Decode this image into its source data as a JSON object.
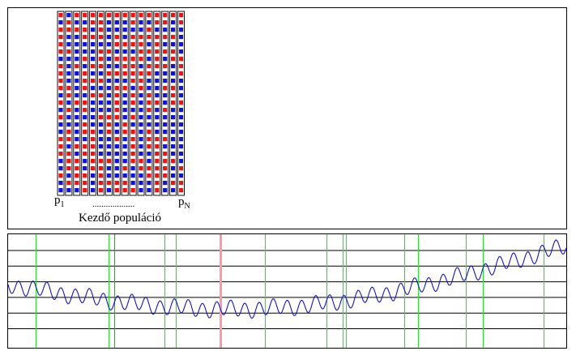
{
  "population_panel": {
    "chromosome_count": 16,
    "genes_per_chromosome": 25,
    "gene_colors": {
      "a": "#1010dd",
      "b": "#ee1111"
    },
    "first_label": {
      "base": "p",
      "sub": "1"
    },
    "last_label": {
      "base": "p",
      "sub": "N"
    },
    "ellipsis": "...................",
    "caption": "Kezdő populáció"
  },
  "fitness_panel": {
    "horizontal_line_count": 6,
    "curve_color": "#1515bb",
    "vertical_lines": [
      {
        "x": 0.05,
        "color": "#33dd33"
      },
      {
        "x": 0.18,
        "color": "#33dd33"
      },
      {
        "x": 0.19,
        "color": "#00cc00"
      },
      {
        "x": 0.28,
        "color": "#33dd33"
      },
      {
        "x": 0.3,
        "color": "#33dd33"
      },
      {
        "x": 0.38,
        "color": "#ff99aa"
      },
      {
        "x": 0.46,
        "color": "#33dd33"
      },
      {
        "x": 0.57,
        "color": "#33dd33"
      },
      {
        "x": 0.6,
        "color": "#33dd33"
      },
      {
        "x": 0.605,
        "color": "#33dd33"
      },
      {
        "x": 0.71,
        "color": "#33dd33"
      },
      {
        "x": 0.735,
        "color": "#33dd33"
      },
      {
        "x": 0.82,
        "color": "#33dd33"
      },
      {
        "x": 0.85,
        "color": "#33dd33"
      },
      {
        "x": 0.96,
        "color": "#33dd33"
      }
    ]
  }
}
